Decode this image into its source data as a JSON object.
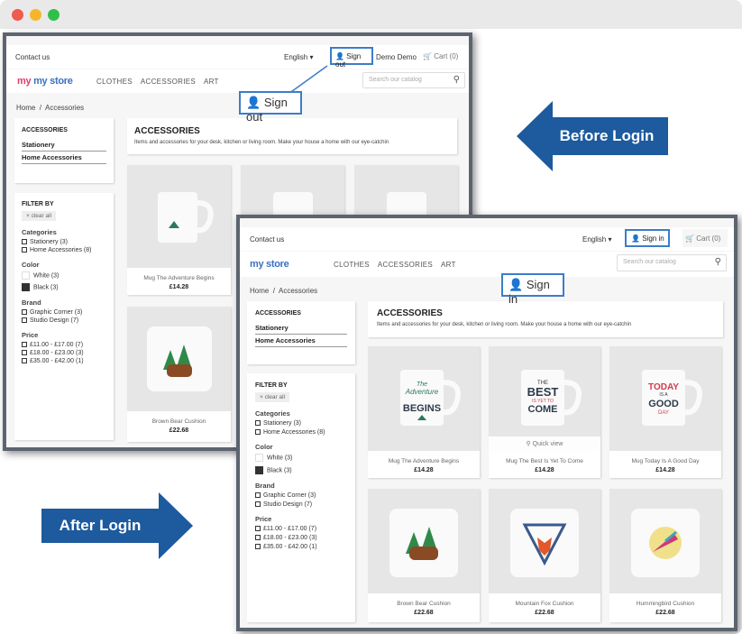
{
  "colors": {
    "arrow": "#1d5a9e",
    "highlight": "#3d7cc9",
    "frame": "#5d6470"
  },
  "labels": {
    "before": "Before Login",
    "after": "After Login"
  },
  "before": {
    "contact": "Contact us",
    "language": "English ▾",
    "account_btn": "Sign out",
    "user": "Demo Demo",
    "cart": "Cart (0)",
    "callout": "Sign out",
    "logo": "my store",
    "nav": [
      "CLOTHES",
      "ACCESSORIES",
      "ART"
    ],
    "search_placeholder": "Search our catalog",
    "breadcrumb": [
      "Home",
      "Accessories"
    ],
    "category_title": "ACCESSORIES",
    "subcats": [
      "Stationery",
      "Home Accessories"
    ],
    "filter_title": "FILTER BY",
    "clear": "clear all",
    "cat_label": "Categories",
    "cats": [
      "Stationery (3)",
      "Home Accessories (8)"
    ],
    "color_label": "Color",
    "colors": [
      "White (3)",
      "Black (3)"
    ],
    "brand_label": "Brand",
    "brands": [
      "Graphic Corner (3)",
      "Studio Design (7)"
    ],
    "price_label": "Price",
    "prices": [
      "£11.00 - £17.00 (7)",
      "£18.00 - £23.00 (3)",
      "£35.00 - £42.00 (1)"
    ],
    "banner_title": "ACCESSORIES",
    "banner_text": "Items and accessories for your desk, kitchen or living room. Make your house a home with our eye-catchin",
    "products": [
      {
        "name": "Mug The Adventure Begins",
        "price": "£14.28"
      },
      {
        "name": "Brown Bear Cushion",
        "price": "£22.68"
      }
    ]
  },
  "after": {
    "contact": "Contact us",
    "language": "English ▾",
    "account_btn": "Sign in",
    "cart": "Cart (0)",
    "callout": "Sign in",
    "logo": "my store",
    "nav": [
      "CLOTHES",
      "ACCESSORIES",
      "ART"
    ],
    "search_placeholder": "Search our catalog",
    "breadcrumb": [
      "Home",
      "Accessories"
    ],
    "category_title": "ACCESSORIES",
    "subcats": [
      "Stationery",
      "Home Accessories"
    ],
    "filter_title": "FILTER BY",
    "clear": "clear all",
    "cat_label": "Categories",
    "cats": [
      "Stationery (3)",
      "Home Accessories (8)"
    ],
    "color_label": "Color",
    "colors": [
      "White (3)",
      "Black (3)"
    ],
    "brand_label": "Brand",
    "brands": [
      "Graphic Corner (3)",
      "Studio Design (7)"
    ],
    "price_label": "Price",
    "prices": [
      "£11.00 - £17.00 (7)",
      "£18.00 - £23.00 (3)",
      "£35.00 - £42.00 (1)"
    ],
    "banner_title": "ACCESSORIES",
    "banner_text": "Items and accessories for your desk, kitchen or living room. Make your house a home with our eye-catchin",
    "quick_view": "Quick view",
    "mug_texts": {
      "adventure_1": "The",
      "adventure_2": "Adventure",
      "adventure_3": "BEGINS",
      "best_1": "THE",
      "best_2": "BEST",
      "best_3": "IS YET TO",
      "best_4": "COME",
      "today_1": "TODAY",
      "today_2": "IS A",
      "today_3": "GOOD",
      "today_4": "DAY"
    },
    "products": [
      {
        "name": "Mug The Adventure Begins",
        "price": "£14.28"
      },
      {
        "name": "Mug The Best Is Yet To Come",
        "price": "£14.28"
      },
      {
        "name": "Mug Today Is A Good Day",
        "price": "£14.28"
      },
      {
        "name": "Brown Bear Cushion",
        "price": "£22.68"
      },
      {
        "name": "Mountain Fox Cushion",
        "price": "£22.68"
      },
      {
        "name": "Hummingbird Cushion",
        "price": "£22.68"
      }
    ]
  }
}
